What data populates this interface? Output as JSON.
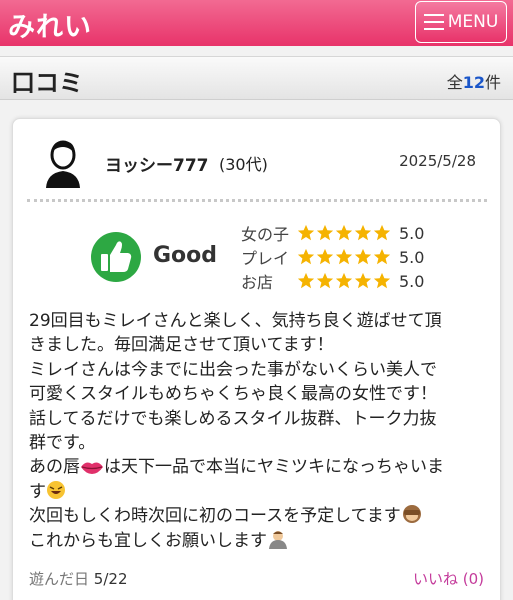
{
  "header": {
    "brand": "みれい",
    "menu_label": "MENU"
  },
  "subheader": {
    "title": "口コミ",
    "count_prefix": "全",
    "count_value": "12",
    "count_suffix": "件"
  },
  "review": {
    "username": "ヨッシー777",
    "age": "(30代)",
    "date": "2025/5/28",
    "verdict": "Good",
    "ratings": [
      {
        "label": "女の子",
        "stars": 5,
        "value": "5.0"
      },
      {
        "label": "プレイ",
        "stars": 5,
        "value": "5.0"
      },
      {
        "label": "お店",
        "stars": 5,
        "value": "5.0"
      }
    ],
    "lines": [
      "29回目もミレイさんと楽しく、気持ち良く遊ばせて頂",
      "きました。毎回満足させて頂いてます！",
      "ミレイさんは今までに出会った事がないくらい美人で",
      "可愛くスタイルもめちゃくちゃ良く最高の女性です！",
      "話してるだけでも楽しめるスタイル抜群、トーク力抜",
      "群です。",
      "あの唇",
      "は天下一品で本当にヤミツキになっちゃいま",
      "す",
      "次回もしくわ時次回に初のコースを予定してます",
      "これからも宜しくお願いします"
    ],
    "played_label": "遊んだ日",
    "played_date": "5/22",
    "like_label": "いいね (0)"
  },
  "colors": {
    "header": "#e8336a",
    "accent_blue": "#1a56c9",
    "star": "#f5b301",
    "good_green": "#2da843",
    "like": "#c43b9b"
  }
}
